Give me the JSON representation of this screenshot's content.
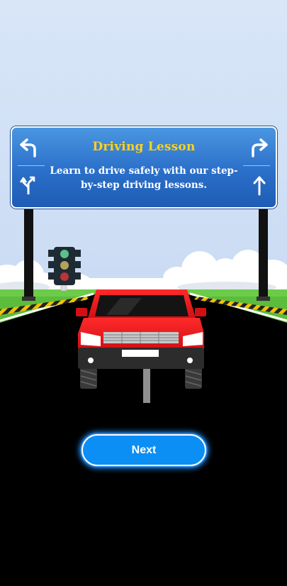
{
  "lesson": {
    "title": "Driving Lesson",
    "description": "Learn to drive safely with our step-by-step driving lessons."
  },
  "actions": {
    "next_label": "Next"
  },
  "colors": {
    "sky": "#cfe0f6",
    "sign_blue": "#2a6fc9",
    "title_yellow": "#ffd21a",
    "car_red": "#e5161b",
    "button_blue": "#0b8ff5",
    "grass": "#5dbe3c"
  },
  "icons": {
    "top_left": "turn-left-arrow-icon",
    "top_right": "turn-right-arrow-icon",
    "bottom_left": "fork-left-arrow-icon",
    "bottom_right": "straight-arrow-icon"
  }
}
